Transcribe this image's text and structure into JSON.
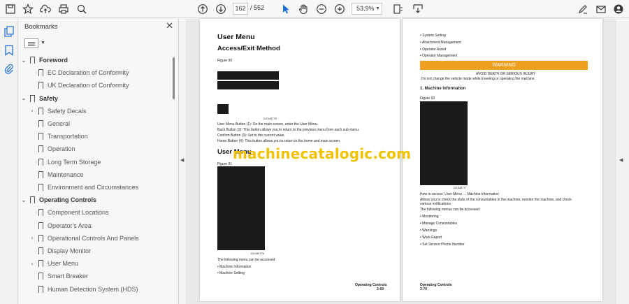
{
  "toolbar": {
    "current_page": "162",
    "total_pages": "/ 552",
    "zoom": "53,9%"
  },
  "bookmarks": {
    "title": "Bookmarks",
    "items": [
      {
        "label": "Foreword",
        "section": true,
        "expanded": true
      },
      {
        "label": "EC Declaration of Conformity"
      },
      {
        "label": "UK Declaration of Conformity"
      },
      {
        "label": "Safety",
        "section": true,
        "expanded": true
      },
      {
        "label": "Safety Decals",
        "collapsed": true
      },
      {
        "label": "General"
      },
      {
        "label": "Transportation"
      },
      {
        "label": "Operation"
      },
      {
        "label": "Long Term Storage"
      },
      {
        "label": "Maintenance"
      },
      {
        "label": "Environment and Circumstances"
      },
      {
        "label": "Operating Controls",
        "section": true,
        "expanded": true
      },
      {
        "label": "Component Locations"
      },
      {
        "label": "Operator's Area"
      },
      {
        "label": "Operational Controls And Panels",
        "collapsed": true
      },
      {
        "label": "Display Monitor"
      },
      {
        "label": "User Menu",
        "collapsed": true
      },
      {
        "label": "Smart Breaker"
      },
      {
        "label": "Human Detection System (HDS)"
      }
    ]
  },
  "left_page": {
    "title": "User Menu",
    "subtitle": "Access/Exit Method",
    "figure90": "Figure 90",
    "figure_code": "DX340775",
    "lines": [
      "User Menu Button (1): On the main screen, enter the User Menu.",
      "Back Button (2): This button allows you to return to the previous menu from each sub-menu.",
      "Confirm Button (3): Set to the current value.",
      "Home Button (4): This button allows you to return to the home and main screen."
    ],
    "heading2": "User Menu",
    "figure91": "Figure 91",
    "figure91_code": "DX340776",
    "menu_intro": "The following menu can be accessed:",
    "bullets": [
      "Machine Information",
      "Machine Setting"
    ],
    "footer_title": "Operating Controls",
    "footer_page": "3-69"
  },
  "right_page": {
    "top_bullets": [
      "System Setting",
      "Attachment Management",
      "Operator Assist",
      "Operator Management"
    ],
    "warning_title": "WARNING",
    "warning_line1": "AVOID DEATH OR SERIOUS INJURY",
    "warning_line2": "Do not change the vehicle mode while traveling or operating the machine.",
    "section_title": "1. Machine Information",
    "figure92": "Figure 92",
    "figure92_code": "DX340777",
    "access": "How to access: User Menu → Machine Information",
    "desc1": "Allows you to check the state of the consumables in the machine, monitor the machine, and check",
    "desc2": "various notifications.",
    "menu_intro": "The following menus can be accessed:",
    "bullets": [
      "Monitoring",
      "Manage Consumables",
      "Warnings",
      "Work Report",
      "Set Service Phone Number"
    ],
    "footer_title": "Operating Controls",
    "footer_page": "3-70"
  },
  "watermark": "machinecatalogic.com"
}
